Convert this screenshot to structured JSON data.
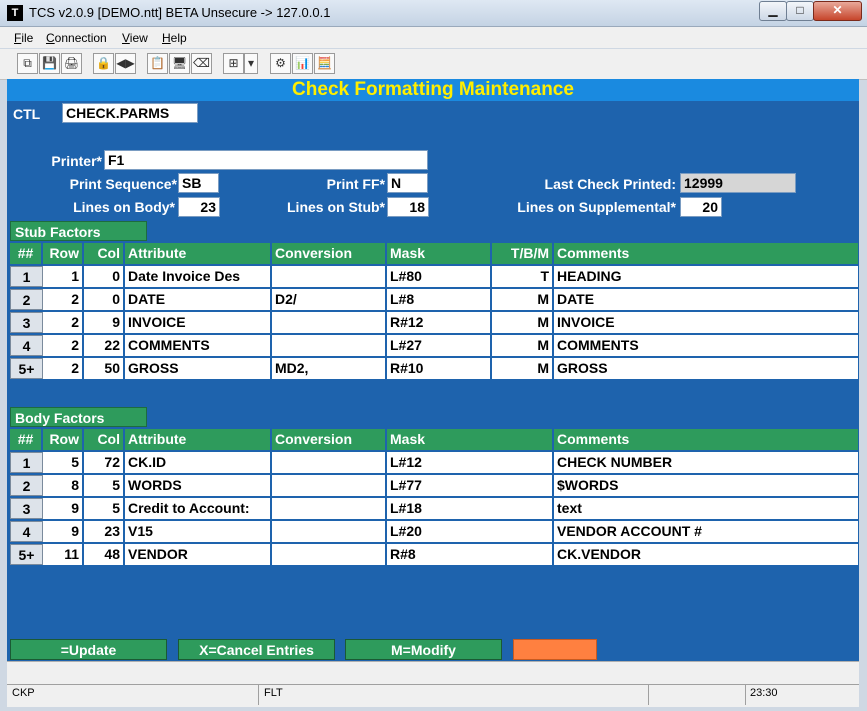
{
  "window": {
    "title": "TCS v2.0.9 [DEMO.ntt] BETA Unsecure -> 127.0.0.1",
    "app_icon_glyph": "T",
    "min_glyph": "▁",
    "max_glyph": "□",
    "close_glyph": "✕"
  },
  "menu": [
    "File",
    "Connection",
    "View",
    "Help"
  ],
  "toolbar_icons": [
    "copy-icon",
    "save-icon",
    "print-icon",
    "lock-icon",
    "record-icon",
    "properties-icon",
    "monitor-icon",
    "eraser-icon",
    "screen-dropdown-icon",
    "network-icon",
    "chart-icon",
    "calculator-icon"
  ],
  "toolbar_glyphs": [
    "⧉",
    "💾",
    "🖨",
    "🔒",
    "◀▶",
    "📋",
    "🖥",
    "⌫",
    "⊞",
    "▾",
    "⚙",
    "📊",
    "🧮"
  ],
  "header": {
    "title": "Check Formatting Maintenance"
  },
  "ctl": {
    "label": "CTL",
    "value": "CHECK.PARMS"
  },
  "form": {
    "printer_label": "Printer*",
    "printer_value": "F1",
    "print_sequence_label": "Print Sequence*",
    "print_sequence_value": "SB",
    "print_ff_label": "Print FF*",
    "print_ff_value": "N",
    "last_check_label": "Last Check Printed:",
    "last_check_value": "12999",
    "lines_body_label": "Lines on Body*",
    "lines_body_value": "23",
    "lines_stub_label": "Lines on Stub*",
    "lines_stub_value": "18",
    "lines_supp_label": "Lines on Supplemental*",
    "lines_supp_value": "20"
  },
  "stub": {
    "title": "Stub Factors",
    "headers": {
      "num": "##",
      "row": "Row",
      "col": "Col",
      "attribute": "Attribute",
      "conversion": "Conversion",
      "mask": "Mask",
      "tbm": "T/B/M",
      "comments": "Comments"
    },
    "rows": [
      {
        "num": "1",
        "row": "1",
        "col": "0",
        "attribute": "Date    Invoice   Des",
        "conversion": "",
        "mask": "L#80",
        "tbm": "T",
        "comments": "HEADING"
      },
      {
        "num": "2",
        "row": "2",
        "col": "0",
        "attribute": "DATE",
        "conversion": "D2/",
        "mask": "L#8",
        "tbm": "M",
        "comments": "DATE"
      },
      {
        "num": "3",
        "row": "2",
        "col": "9",
        "attribute": "INVOICE",
        "conversion": "",
        "mask": "R#12",
        "tbm": "M",
        "comments": "INVOICE"
      },
      {
        "num": "4",
        "row": "2",
        "col": "22",
        "attribute": "COMMENTS",
        "conversion": "",
        "mask": "L#27",
        "tbm": "M",
        "comments": "COMMENTS"
      },
      {
        "num": "5+",
        "row": "2",
        "col": "50",
        "attribute": "GROSS",
        "conversion": "MD2,",
        "mask": "R#10",
        "tbm": "M",
        "comments": "GROSS"
      }
    ]
  },
  "body": {
    "title": "Body Factors",
    "headers": {
      "num": "##",
      "row": "Row",
      "col": "Col",
      "attribute": "Attribute",
      "conversion": "Conversion",
      "mask": "Mask",
      "comments": "Comments"
    },
    "rows": [
      {
        "num": "1",
        "row": "5",
        "col": "72",
        "attribute": "CK.ID",
        "conversion": "",
        "mask": "L#12",
        "comments": "CHECK NUMBER"
      },
      {
        "num": "2",
        "row": "8",
        "col": "5",
        "attribute": "WORDS",
        "conversion": "",
        "mask": "L#77",
        "comments": "$WORDS"
      },
      {
        "num": "3",
        "row": "9",
        "col": "5",
        "attribute": "Credit to Account:",
        "conversion": "",
        "mask": "L#18",
        "comments": "text"
      },
      {
        "num": "4",
        "row": "9",
        "col": "23",
        "attribute": "V15",
        "conversion": "",
        "mask": "L#20",
        "comments": "VENDOR ACCOUNT #"
      },
      {
        "num": "5+",
        "row": "11",
        "col": "48",
        "attribute": "VENDOR",
        "conversion": "",
        "mask": "R#8",
        "comments": "CK.VENDOR"
      }
    ]
  },
  "footer_buttons": {
    "update": "=Update",
    "cancel": "X=Cancel Entries",
    "modify": "M=Modify",
    "orange": ""
  },
  "status": {
    "mode": "CKP",
    "flt": "FLT",
    "time": "23:30"
  },
  "colors": {
    "main_bg": "#1e63ad",
    "header_bg": "#1a8ae0",
    "header_text": "#ffee00",
    "green": "#2e9b5c",
    "orange": "#ff8040"
  }
}
